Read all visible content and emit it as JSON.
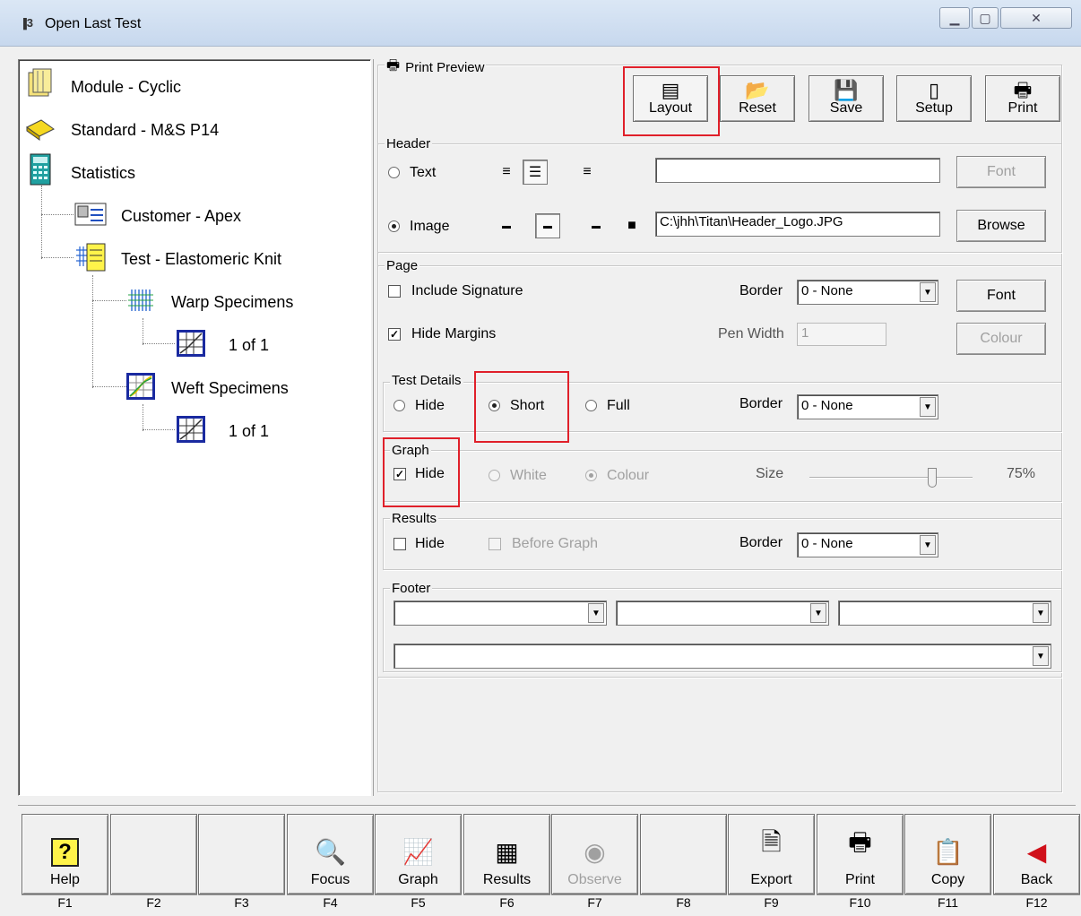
{
  "window": {
    "title": "Open Last Test",
    "icon_text": "3"
  },
  "tree": [
    {
      "label": "Module - Cyclic",
      "icon": "module-icon"
    },
    {
      "label": "Standard - M&S P14",
      "icon": "book-icon"
    },
    {
      "label": "Statistics",
      "icon": "calculator-icon"
    },
    {
      "label": "Customer - Apex",
      "icon": "customer-card-icon"
    },
    {
      "label": "Test - Elastomeric Knit",
      "icon": "test-icon"
    },
    {
      "label": "Warp Specimens",
      "icon": "warp-icon"
    },
    {
      "label": "1 of 1",
      "icon": "graph-grid-icon"
    },
    {
      "label": "Weft Specimens",
      "icon": "weft-icon"
    },
    {
      "label": "1 of 1",
      "icon": "graph-grid-icon"
    }
  ],
  "preview": {
    "title": "Print Preview",
    "toolbar": {
      "layout": "Layout",
      "reset": "Reset",
      "save": "Save",
      "setup": "Setup",
      "print": "Print"
    },
    "header": {
      "legend": "Header",
      "text_option": "Text",
      "image_option": "Image",
      "selected": "Image",
      "text_value": "",
      "image_path": "C:\\jhh\\Titan\\Header_Logo.JPG",
      "font_button": "Font",
      "browse_button": "Browse"
    },
    "page": {
      "legend": "Page",
      "include_signature": "Include Signature",
      "include_signature_checked": false,
      "hide_margins": "Hide Margins",
      "hide_margins_checked": true,
      "border_label": "Border",
      "border_value": "0 - None",
      "font_button": "Font",
      "pen_width_label": "Pen Width",
      "pen_width_value": "1",
      "colour_button": "Colour"
    },
    "test_details": {
      "legend": "Test Details",
      "hide": "Hide",
      "short": "Short",
      "full": "Full",
      "selected": "Short",
      "border_label": "Border",
      "border_value": "0 - None"
    },
    "graph": {
      "legend": "Graph",
      "hide": "Hide",
      "hide_checked": true,
      "white": "White",
      "colour": "Colour",
      "selected": "Colour",
      "size_label": "Size",
      "size_value": "75%",
      "size_fraction": 0.75
    },
    "results": {
      "legend": "Results",
      "hide": "Hide",
      "hide_checked": false,
      "before_graph": "Before Graph",
      "before_graph_checked": false,
      "border_label": "Border",
      "border_value": "0 - None"
    },
    "footer": {
      "legend": "Footer",
      "left": "",
      "center": "",
      "right": "",
      "bottom": ""
    }
  },
  "fkeys": [
    {
      "key": "F1",
      "label": "Help",
      "icon": "help-icon",
      "glyph": "?",
      "enabled": true
    },
    {
      "key": "F2",
      "label": "",
      "icon": "",
      "glyph": "",
      "enabled": true
    },
    {
      "key": "F3",
      "label": "",
      "icon": "",
      "glyph": "",
      "enabled": true
    },
    {
      "key": "F4",
      "label": "Focus",
      "icon": "focus-magnifier-icon",
      "glyph": "🔍",
      "enabled": true
    },
    {
      "key": "F5",
      "label": "Graph",
      "icon": "graph-icon",
      "glyph": "📈",
      "enabled": true
    },
    {
      "key": "F6",
      "label": "Results",
      "icon": "results-table-icon",
      "glyph": "▦",
      "enabled": true
    },
    {
      "key": "F7",
      "label": "Observe",
      "icon": "observe-eye-icon",
      "glyph": "◉",
      "enabled": false
    },
    {
      "key": "F8",
      "label": "",
      "icon": "",
      "glyph": "",
      "enabled": true
    },
    {
      "key": "F9",
      "label": "Export",
      "icon": "export-icon",
      "glyph": "🗎",
      "enabled": true
    },
    {
      "key": "F10",
      "label": "Print",
      "icon": "print-icon",
      "glyph": "🖶",
      "enabled": true
    },
    {
      "key": "F11",
      "label": "Copy",
      "icon": "copy-clipboard-icon",
      "glyph": "📋",
      "enabled": true
    },
    {
      "key": "F12",
      "label": "Back",
      "icon": "back-arrow-icon",
      "glyph": "◀",
      "enabled": true
    }
  ],
  "colors": {
    "highlight": "#e0202a",
    "titlebar": "#c7d8ee",
    "back_arrow": "#d0101a"
  }
}
